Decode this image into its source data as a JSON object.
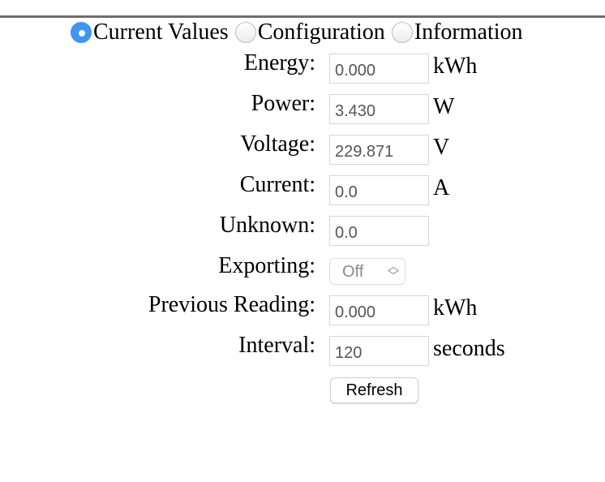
{
  "tabs": [
    {
      "label": "Current Values",
      "selected": true
    },
    {
      "label": "Configuration",
      "selected": false
    },
    {
      "label": "Information",
      "selected": false
    }
  ],
  "fields": [
    {
      "label": "Energy:",
      "value": "0.000",
      "unit": "kWh"
    },
    {
      "label": "Power:",
      "value": "3.430",
      "unit": "W"
    },
    {
      "label": "Voltage:",
      "value": "229.871",
      "unit": "V"
    },
    {
      "label": "Current:",
      "value": "0.0",
      "unit": "A"
    },
    {
      "label": "Unknown:",
      "value": "0.0",
      "unit": ""
    },
    {
      "label": "Exporting:",
      "value": "Off",
      "unit": ""
    },
    {
      "label": "Previous Reading:",
      "value": "0.000",
      "unit": "kWh"
    },
    {
      "label": "Interval:",
      "value": "120",
      "unit": "seconds"
    }
  ],
  "refresh_label": "Refresh",
  "colors": {
    "accent": "#3d95f5",
    "divider": "#6e6e6e"
  }
}
